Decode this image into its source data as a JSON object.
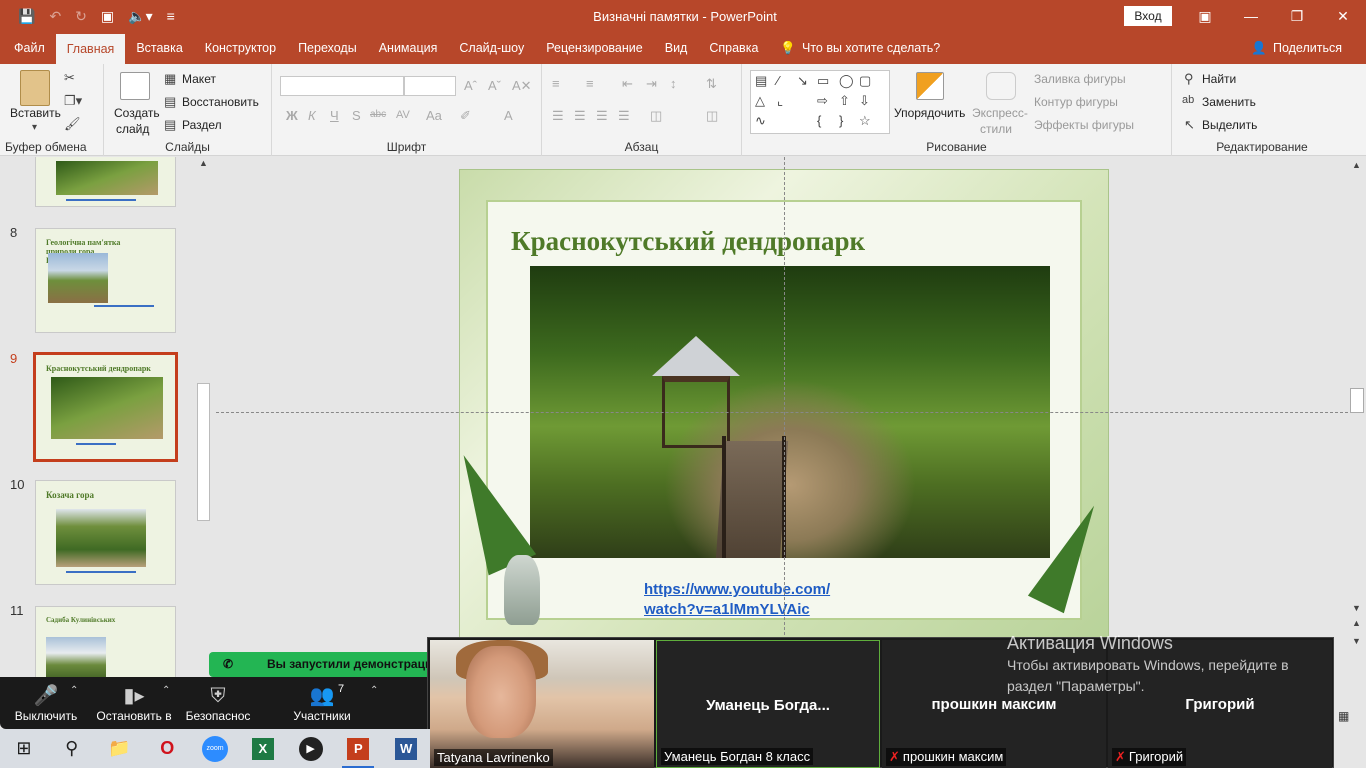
{
  "titlebar": {
    "document_title": "Визначні памятки  -  PowerPoint",
    "signin_label": "Вход"
  },
  "tabs": [
    "Файл",
    "Главная",
    "Вставка",
    "Конструктор",
    "Переходы",
    "Анимация",
    "Слайд-шоу",
    "Рецензирование",
    "Вид",
    "Справка"
  ],
  "active_tab": "Главная",
  "tell_me": "Что вы хотите сделать?",
  "share_label": "Поделиться",
  "ribbon": {
    "clipboard": {
      "label": "Буфер обмена",
      "paste": "Вставить"
    },
    "slides": {
      "label": "Слайды",
      "new_slide_line1": "Создать",
      "new_slide_line2": "слайд",
      "layout": "Макет",
      "reset": "Восстановить",
      "section": "Раздел"
    },
    "font": {
      "label": "Шрифт",
      "bold": "Ж",
      "italic": "К",
      "underline": "Ч",
      "shadow": "S",
      "strike": "abc",
      "spacing": "AV",
      "case": "Aa",
      "color": "A"
    },
    "paragraph": {
      "label": "Абзац"
    },
    "drawing": {
      "label": "Рисование",
      "arrange": "Упорядочить",
      "quick_styles_line1": "Экспресс-",
      "quick_styles_line2": "стили",
      "fill": "Заливка фигуры",
      "outline": "Контур фигуры",
      "effects": "Эффекты фигуры"
    },
    "editing": {
      "label": "Редактирование",
      "find": "Найти",
      "replace": "Заменить",
      "select": "Выделить"
    }
  },
  "thumbnails": [
    {
      "number": "",
      "title": ""
    },
    {
      "number": "8",
      "title": "Геологічна пам'ятка природи гора Крем'янець"
    },
    {
      "number": "9",
      "title": "Краснокутський дендропарк"
    },
    {
      "number": "10",
      "title": "Козача гора"
    },
    {
      "number": "11",
      "title": "Садиба Кулинівських"
    }
  ],
  "slide": {
    "title": "Краснокутський дендропарк",
    "link_line1": "https://www.youtube.com/",
    "link_line2": "watch?v=a1lMmYLVAic"
  },
  "zoom": {
    "notification": "Вы запустили демонстрацию",
    "controls": [
      {
        "label": "Выключить",
        "icon": "microphone-icon"
      },
      {
        "label": "Остановить в",
        "icon": "video-camera-icon"
      },
      {
        "label": "Безопаснос",
        "icon": "shield-icon"
      },
      {
        "label": "Участники",
        "icon": "participants-icon",
        "count": "7"
      }
    ],
    "participants": [
      {
        "display": "",
        "label": "Tatyana Lavrinenko",
        "muted": false
      },
      {
        "display": "Уманець  Богда...",
        "label": "Уманець Богдан 8 класс",
        "muted": false
      },
      {
        "display": "прошкин максим",
        "label": "прошкин максим",
        "muted": true
      },
      {
        "display": "Григорий",
        "label": "Григорий",
        "muted": true
      }
    ]
  },
  "activation": {
    "title": "Активация Windows",
    "line1": "Чтобы активировать Windows, перейдите в",
    "line2": "раздел \"Параметры\"."
  },
  "colors": {
    "brand": "#b7472a",
    "slide_title": "#4f7a28",
    "link": "#1f5cc4",
    "zoom_green": "#23b553"
  }
}
